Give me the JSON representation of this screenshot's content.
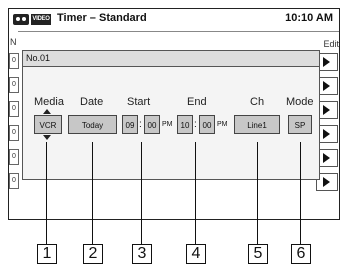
{
  "header": {
    "title": "Timer – Standard",
    "time": "10:10 AM",
    "video_icon_text": "VIDEO"
  },
  "background_list": {
    "col_label": "N",
    "edit_label": "Edit",
    "row_prefix": "0"
  },
  "dialog": {
    "title": "No.01",
    "labels": {
      "media": "Media",
      "date": "Date",
      "start": "Start",
      "end": "End",
      "ch": "Ch",
      "mode": "Mode"
    },
    "fields": {
      "media": "VCR",
      "date": "Today",
      "start_hour": "09",
      "start_min": "00",
      "start_ampm": "PM",
      "end_hour": "10",
      "end_min": "00",
      "end_ampm": "PM",
      "ch": "Line1",
      "mode": "SP"
    },
    "colon": ":"
  },
  "callouts": [
    "1",
    "2",
    "3",
    "4",
    "5",
    "6"
  ]
}
